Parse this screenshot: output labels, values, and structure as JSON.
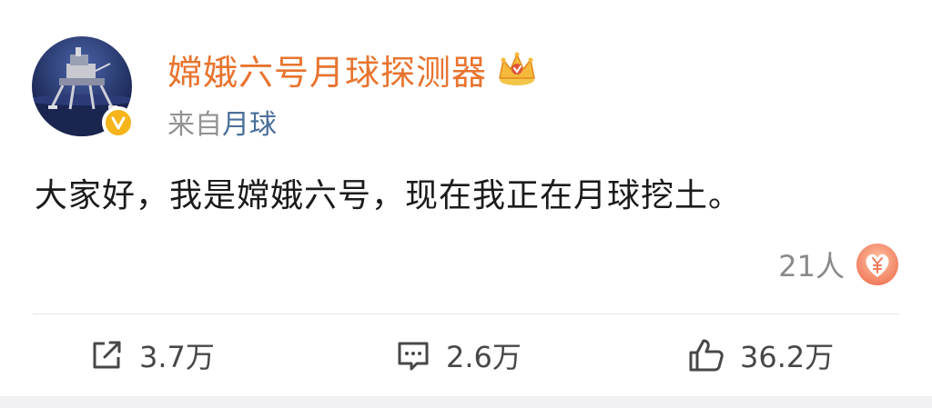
{
  "post": {
    "username": "嫦娥六号月球探测器",
    "source_prefix": "来自",
    "source_name": "月球",
    "text": "大家好，我是嫦娥六号，现在我正在月球挖土。",
    "reward_count": "21人",
    "icons": {
      "avatar": "lunar-lander-avatar",
      "verified": "verified-badge-v",
      "crown": "vip-crown-icon",
      "reward": "heart-yen-reward-icon",
      "repost": "repost-icon",
      "comment": "comment-icon",
      "like": "thumbs-up-icon"
    },
    "actions": {
      "repost_count": "3.7万",
      "comment_count": "2.6万",
      "like_count": "36.2万"
    },
    "colors": {
      "username": "#e8742f",
      "source_link": "#4a6f9a",
      "verified": "#f5b51b",
      "reward": "#f07a5a"
    }
  }
}
